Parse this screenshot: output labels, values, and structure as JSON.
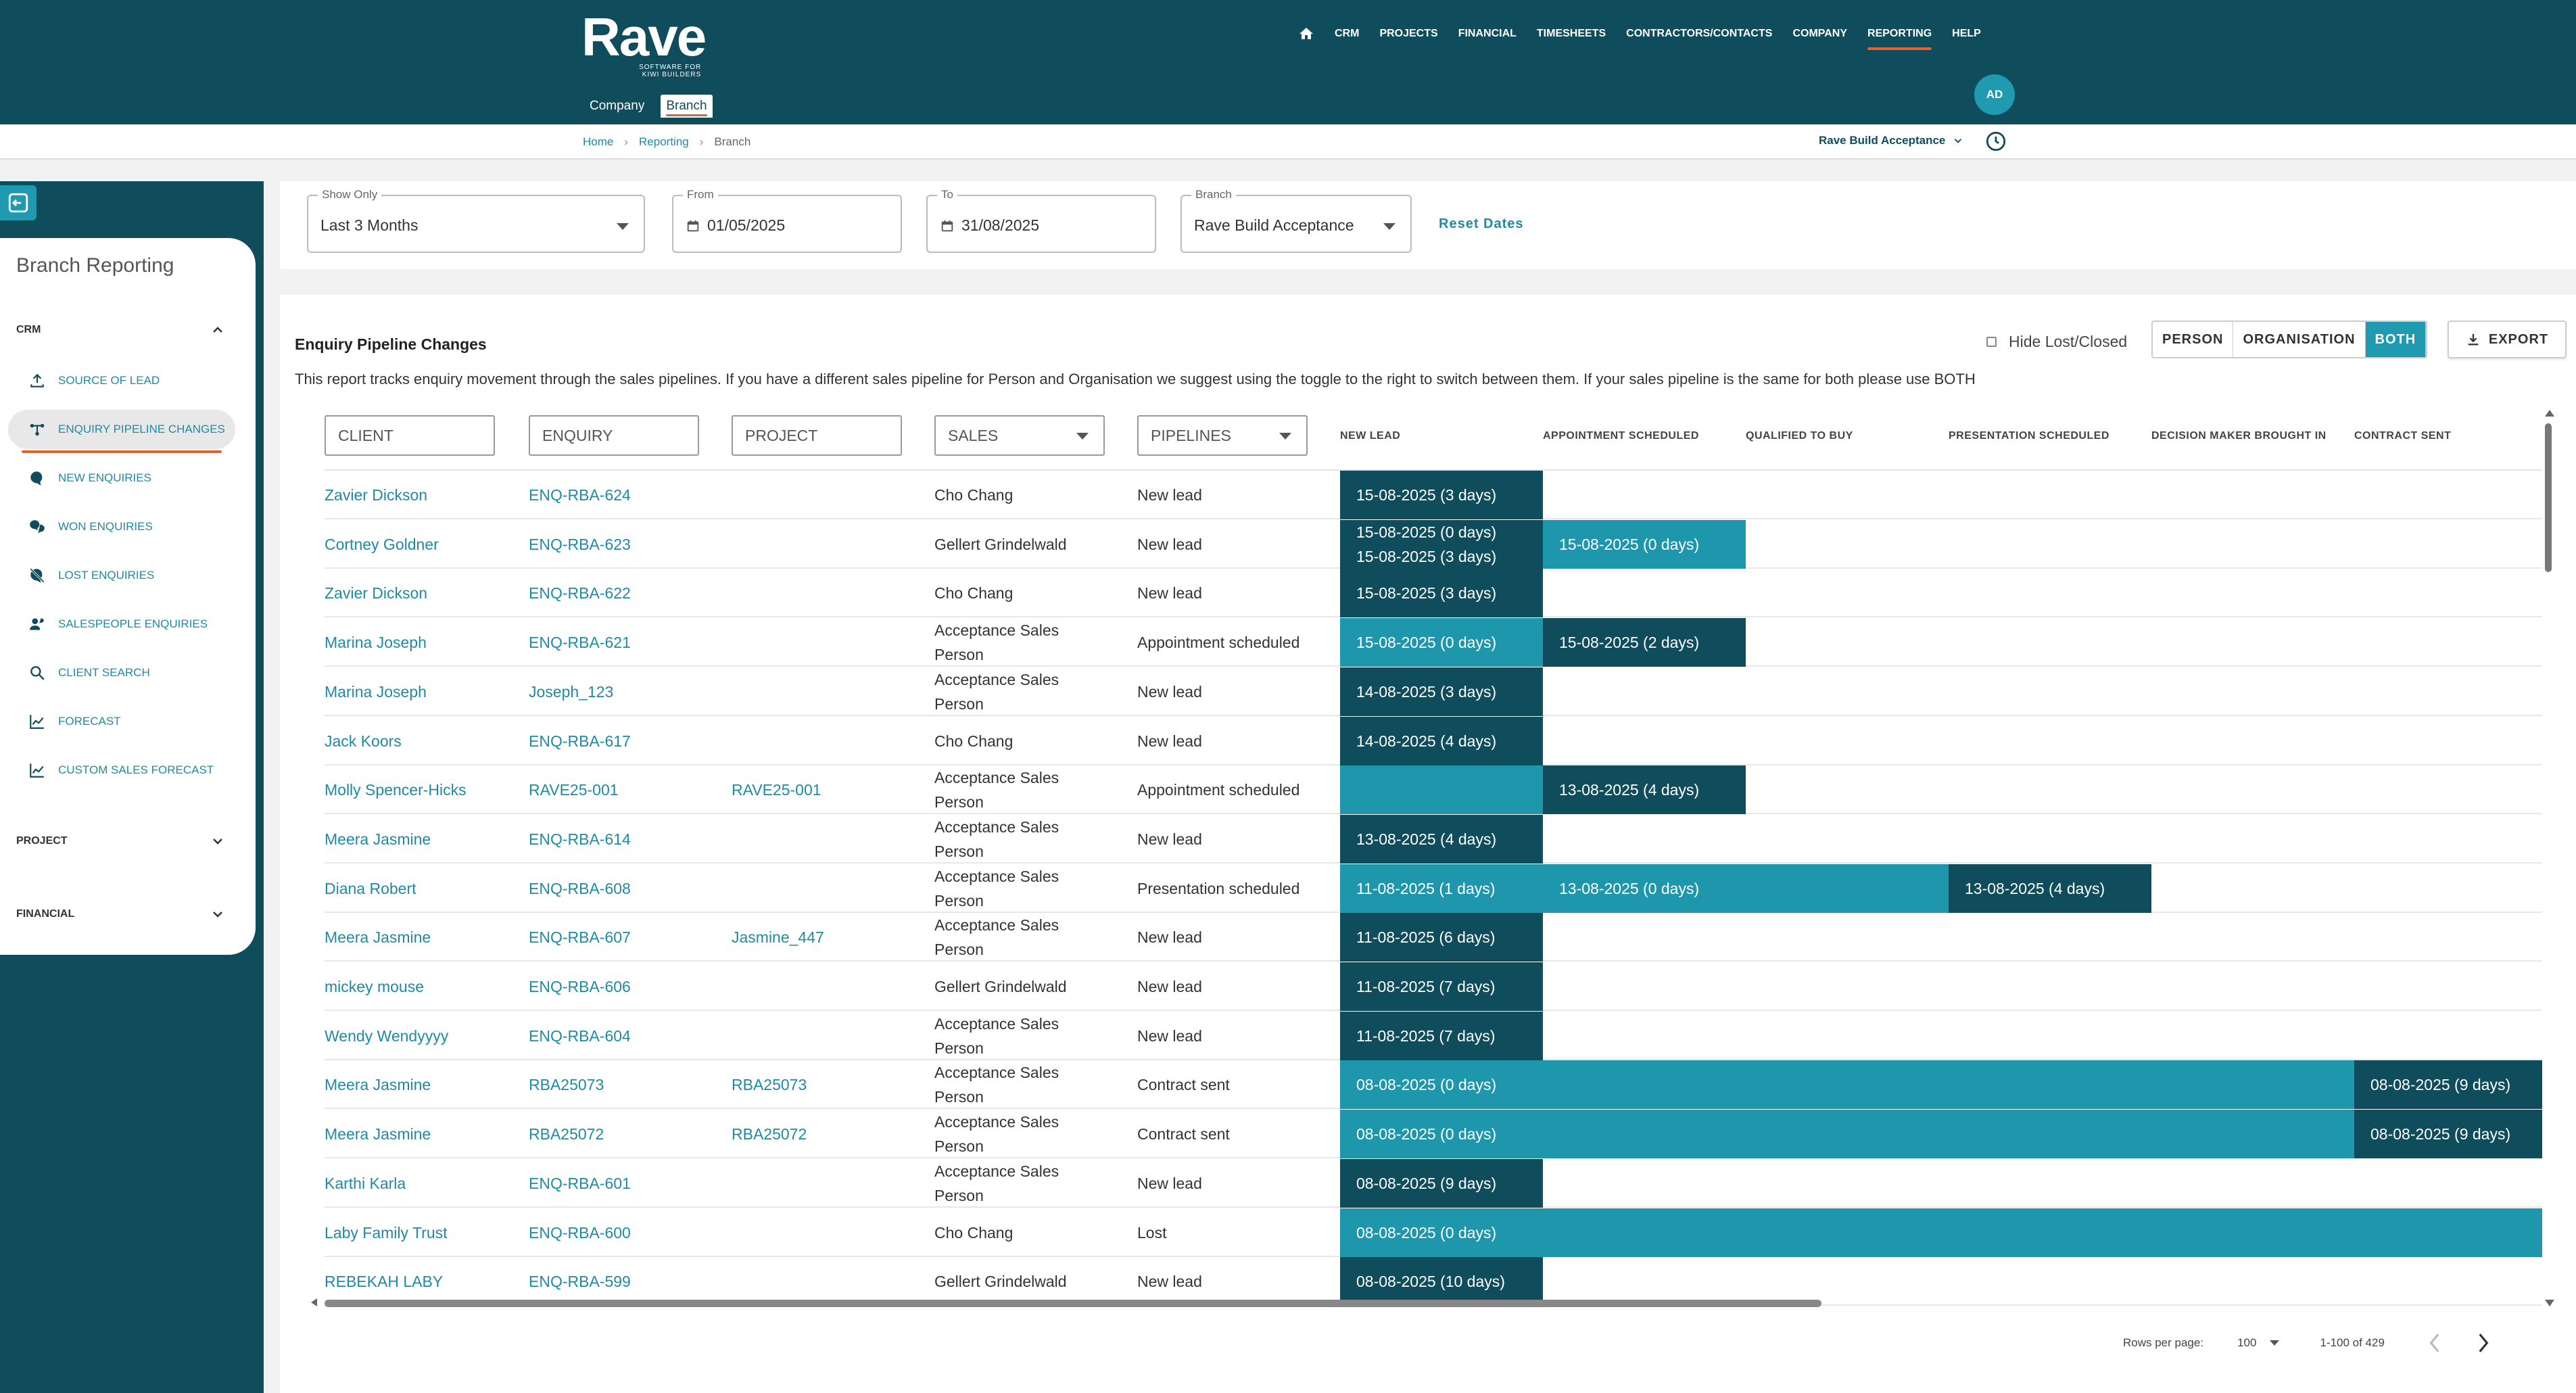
{
  "header": {
    "logo_text": "Rave",
    "logo_tagline_1": "SOFTWARE FOR",
    "logo_tagline_2": "KIWI BUILDERS",
    "nav": [
      "CRM",
      "PROJECTS",
      "FINANCIAL",
      "TIMESHEETS",
      "CONTRACTORS/CONTACTS",
      "COMPANY",
      "REPORTING",
      "HELP"
    ],
    "active_nav": "REPORTING",
    "avatar_initials": "AD",
    "subnav": [
      "Company",
      "Branch"
    ],
    "active_subnav": "Branch"
  },
  "breadcrumb": {
    "items": [
      "Home",
      "Reporting"
    ],
    "current": "Branch"
  },
  "tenant": {
    "name": "Rave Build Acceptance"
  },
  "sidebar": {
    "title": "Branch Reporting",
    "sections": {
      "crm": "CRM",
      "project": "PROJECT",
      "financial": "FINANCIAL"
    },
    "items": [
      {
        "label": "SOURCE OF LEAD",
        "icon": "upload-icon"
      },
      {
        "label": "ENQUIRY PIPELINE CHANGES",
        "icon": "pipeline-icon",
        "active": true
      },
      {
        "label": "NEW ENQUIRIES",
        "icon": "chat-icon"
      },
      {
        "label": "WON ENQUIRIES",
        "icon": "chat-double-icon"
      },
      {
        "label": "LOST ENQUIRIES",
        "icon": "chat-off-icon"
      },
      {
        "label": "SALESPEOPLE ENQUIRIES",
        "icon": "person-chat-icon"
      },
      {
        "label": "CLIENT SEARCH",
        "icon": "search-icon"
      },
      {
        "label": "FORECAST",
        "icon": "chart-line-icon"
      },
      {
        "label": "CUSTOM SALES FORECAST",
        "icon": "chart-line-icon"
      }
    ]
  },
  "filters": {
    "show_only": {
      "label": "Show Only",
      "value": "Last 3 Months"
    },
    "from": {
      "label": "From",
      "value": "01/05/2025"
    },
    "to": {
      "label": "To",
      "value": "31/08/2025"
    },
    "branch": {
      "label": "Branch",
      "value": "Rave Build Acceptance"
    },
    "reset_label": "Reset Dates"
  },
  "report": {
    "title": "Enquiry Pipeline Changes",
    "description": "This report tracks enquiry movement through the sales pipelines. If you have a different sales pipeline for Person and Organisation we suggest using the toggle to the right to switch between them. If your sales pipeline is the same for both please use BOTH",
    "hide_lost_label": "Hide Lost/Closed",
    "toggle": [
      "PERSON",
      "ORGANISATION",
      "BOTH"
    ],
    "active_toggle": "BOTH",
    "export_label": "EXPORT",
    "column_filters": {
      "client": "CLIENT",
      "enquiry": "ENQUIRY",
      "project": "PROJECT",
      "sales": "SALES",
      "pipelines": "PIPELINES"
    },
    "stages": [
      "NEW LEAD",
      "APPOINTMENT SCHEDULED",
      "QUALIFIED TO BUY",
      "PRESENTATION SCHEDULED",
      "DECISION MAKER BROUGHT IN",
      "CONTRACT SENT"
    ],
    "colors": {
      "dark": "#0f4c5c",
      "light": "#1e97ad",
      "accent": "#e8612c"
    },
    "rows": [
      {
        "client": "Zavier Dickson",
        "enquiry": "ENQ-RBA-624",
        "project": "",
        "sales": "Cho Chang",
        "pipeline": "New lead",
        "bars": [
          {
            "stage": 0,
            "span": 1,
            "tone": "dark",
            "text": [
              "15-08-2025 (3 days)"
            ]
          }
        ]
      },
      {
        "client": "Cortney Goldner",
        "enquiry": "ENQ-RBA-623",
        "project": "",
        "sales": "Gellert Grindelwald",
        "pipeline": "New lead",
        "bars": [
          {
            "stage": 0,
            "span": 1,
            "tone": "dark",
            "text": [
              "15-08-2025 (0 days)",
              "15-08-2025 (3 days)"
            ]
          },
          {
            "stage": 1,
            "span": 1,
            "tone": "light",
            "text": [
              "15-08-2025 (0 days)"
            ]
          }
        ]
      },
      {
        "client": "Zavier Dickson",
        "enquiry": "ENQ-RBA-622",
        "project": "",
        "sales": "Cho Chang",
        "pipeline": "New lead",
        "bars": [
          {
            "stage": 0,
            "span": 1,
            "tone": "dark",
            "text": [
              "15-08-2025 (3 days)"
            ]
          }
        ]
      },
      {
        "client": "Marina Joseph",
        "enquiry": "ENQ-RBA-621",
        "project": "",
        "sales": "Acceptance Sales Person",
        "pipeline": "Appointment scheduled",
        "bars": [
          {
            "stage": 0,
            "span": 1,
            "tone": "light",
            "text": [
              "15-08-2025 (0 days)"
            ]
          },
          {
            "stage": 1,
            "span": 1,
            "tone": "dark",
            "text": [
              "15-08-2025 (2 days)"
            ]
          }
        ]
      },
      {
        "client": "Marina Joseph",
        "enquiry": "Joseph_123",
        "project": "",
        "sales": "Acceptance Sales Person",
        "pipeline": "New lead",
        "bars": [
          {
            "stage": 0,
            "span": 1,
            "tone": "dark",
            "text": [
              "14-08-2025 (3 days)"
            ]
          }
        ]
      },
      {
        "client": "Jack Koors",
        "enquiry": "ENQ-RBA-617",
        "project": "",
        "sales": "Cho Chang",
        "pipeline": "New lead",
        "bars": [
          {
            "stage": 0,
            "span": 1,
            "tone": "dark",
            "text": [
              "14-08-2025 (4 days)"
            ]
          }
        ]
      },
      {
        "client": "Molly Spencer-Hicks",
        "enquiry": "RAVE25-001",
        "project": "RAVE25-001",
        "sales": "Acceptance Sales Person",
        "pipeline": "Appointment scheduled",
        "bars": [
          {
            "stage": 0,
            "span": 1,
            "tone": "light",
            "text": []
          },
          {
            "stage": 1,
            "span": 1,
            "tone": "dark",
            "text": [
              "13-08-2025 (4 days)"
            ]
          }
        ]
      },
      {
        "client": "Meera Jasmine",
        "enquiry": "ENQ-RBA-614",
        "project": "",
        "sales": "Acceptance Sales Person",
        "pipeline": "New lead",
        "bars": [
          {
            "stage": 0,
            "span": 1,
            "tone": "dark",
            "text": [
              "13-08-2025 (4 days)"
            ]
          }
        ]
      },
      {
        "client": "Diana Robert",
        "enquiry": "ENQ-RBA-608",
        "project": "",
        "sales": "Acceptance Sales Person",
        "pipeline": "Presentation scheduled",
        "bars": [
          {
            "stage": 0,
            "span": 1,
            "tone": "light",
            "text": [
              "11-08-2025 (1 days)"
            ]
          },
          {
            "stage": 1,
            "span": 2,
            "tone": "light",
            "text": [
              "13-08-2025 (0 days)"
            ]
          },
          {
            "stage": 3,
            "span": 1,
            "tone": "dark",
            "text": [
              "13-08-2025 (4 days)"
            ]
          }
        ]
      },
      {
        "client": "Meera Jasmine",
        "enquiry": "ENQ-RBA-607",
        "project": "Jasmine_447",
        "sales": "Acceptance Sales Person",
        "pipeline": "New lead",
        "bars": [
          {
            "stage": 0,
            "span": 1,
            "tone": "dark",
            "text": [
              "11-08-2025 (6 days)"
            ]
          }
        ]
      },
      {
        "client": "mickey mouse",
        "enquiry": "ENQ-RBA-606",
        "project": "",
        "sales": "Gellert Grindelwald",
        "pipeline": "New lead",
        "bars": [
          {
            "stage": 0,
            "span": 1,
            "tone": "dark",
            "text": [
              "11-08-2025 (7 days)"
            ]
          }
        ]
      },
      {
        "client": "Wendy Wendyyyy",
        "enquiry": "ENQ-RBA-604",
        "project": "",
        "sales": "Acceptance Sales Person",
        "pipeline": "New lead",
        "bars": [
          {
            "stage": 0,
            "span": 1,
            "tone": "dark",
            "text": [
              "11-08-2025 (7 days)"
            ]
          }
        ]
      },
      {
        "client": "Meera Jasmine",
        "enquiry": "RBA25073",
        "project": "RBA25073",
        "sales": "Acceptance Sales Person",
        "pipeline": "Contract sent",
        "bars": [
          {
            "stage": 0,
            "span": 5,
            "tone": "light",
            "text": [
              "08-08-2025 (0 days)"
            ]
          },
          {
            "stage": 5,
            "span": 1,
            "tone": "dark",
            "text": [
              "08-08-2025 (9 days)"
            ]
          }
        ]
      },
      {
        "client": "Meera Jasmine",
        "enquiry": "RBA25072",
        "project": "RBA25072",
        "sales": "Acceptance Sales Person",
        "pipeline": "Contract sent",
        "bars": [
          {
            "stage": 0,
            "span": 5,
            "tone": "light",
            "text": [
              "08-08-2025 (0 days)"
            ]
          },
          {
            "stage": 5,
            "span": 1,
            "tone": "dark",
            "text": [
              "08-08-2025 (9 days)"
            ]
          }
        ]
      },
      {
        "client": "Karthi Karla",
        "enquiry": "ENQ-RBA-601",
        "project": "",
        "sales": "Acceptance Sales Person",
        "pipeline": "New lead",
        "bars": [
          {
            "stage": 0,
            "span": 1,
            "tone": "dark",
            "text": [
              "08-08-2025 (9 days)"
            ]
          }
        ]
      },
      {
        "client": "Laby Family Trust",
        "enquiry": "ENQ-RBA-600",
        "project": "",
        "sales": "Cho Chang",
        "pipeline": "Lost",
        "bars": [
          {
            "stage": 0,
            "span": 6,
            "tone": "light",
            "text": [
              "08-08-2025 (0 days)"
            ]
          }
        ]
      },
      {
        "client": "REBEKAH LABY",
        "enquiry": "ENQ-RBA-599",
        "project": "",
        "sales": "Gellert Grindelwald",
        "pipeline": "New lead",
        "bars": [
          {
            "stage": 0,
            "span": 1,
            "tone": "dark",
            "text": [
              "08-08-2025 (10 days)"
            ]
          }
        ]
      }
    ]
  },
  "pagination": {
    "rows_per_page_label": "Rows per page:",
    "rows_per_page": "100",
    "range": "1-100 of 429"
  }
}
